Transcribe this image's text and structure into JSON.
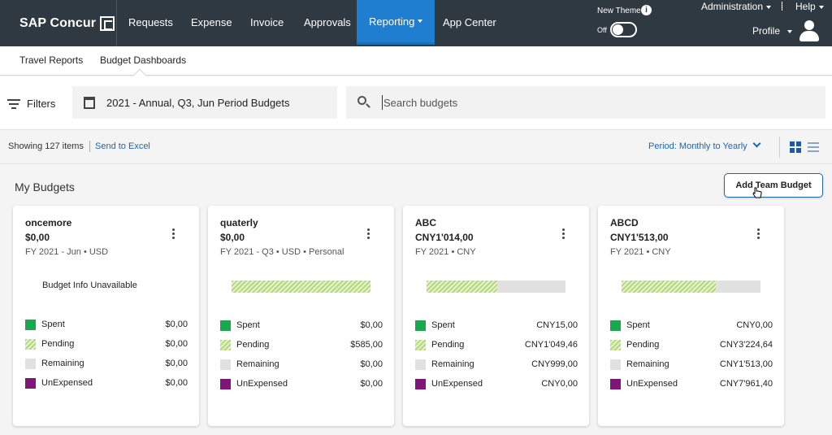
{
  "brand": {
    "name": "SAP Concur"
  },
  "nav": {
    "items": [
      {
        "label": "Requests"
      },
      {
        "label": "Expense"
      },
      {
        "label": "Invoice"
      },
      {
        "label": "Approvals"
      },
      {
        "label": "Reporting"
      },
      {
        "label": "App Center"
      }
    ],
    "active": "Reporting",
    "new_theme_label": "New Theme",
    "toggle_state": "Off",
    "administration": "Administration",
    "help": "Help",
    "profile": "Profile"
  },
  "subnav": {
    "tabs": [
      {
        "label": "Travel Reports"
      },
      {
        "label": "Budget Dashboards"
      }
    ],
    "active": "Budget Dashboards"
  },
  "filterbar": {
    "filters_label": "Filters",
    "period": "2021 - Annual, Q3, Jun Period Budgets",
    "search_placeholder": "Search budgets"
  },
  "toolbar": {
    "showing": "Showing 127 items",
    "send_to_excel": "Send to Excel",
    "period_select": "Period: Monthly to Yearly"
  },
  "main": {
    "title": "My Budgets",
    "add_button": "Add Team Budget"
  },
  "legend_labels": {
    "spent": "Spent",
    "pending": "Pending",
    "remaining": "Remaining",
    "unexpensed": "UnExpensed"
  },
  "colors": {
    "spent": "#1aa84f",
    "pending": "#b4d97d",
    "remaining": "#e1e1e1",
    "unexpensed": "#7e1579",
    "nav_bg": "#2f3941",
    "active_tab": "#1f7ed0",
    "link": "#1a66b5"
  },
  "cards": [
    {
      "name": "oncemore",
      "amount": "$0,00",
      "meta": "FY 2021 - Jun • USD",
      "info_unavailable": "Budget Info Unavailable",
      "spent": "$0,00",
      "pending": "$0,00",
      "remaining": "$0,00",
      "unexpensed": "$0,00"
    },
    {
      "name": "quaterly",
      "amount": "$0,00",
      "meta": "FY 2021 - Q3 • USD • Personal",
      "pending_fraction": 1.0,
      "spent": "$0,00",
      "pending": "$585,00",
      "remaining": "$0,00",
      "unexpensed": "$0,00"
    },
    {
      "name": "ABC",
      "amount": "CNY1'014,00",
      "meta": "FY 2021 • CNY",
      "pending_fraction": 0.51,
      "spent": "CNY15,00",
      "pending": "CNY1'049,46",
      "remaining": "CNY999,00",
      "unexpensed": "CNY0,00"
    },
    {
      "name": "ABCD",
      "amount": "CNY1'513,00",
      "meta": "FY 2021 • CNY",
      "pending_fraction": 0.68,
      "spent": "CNY0,00",
      "pending": "CNY3'224,64",
      "remaining": "CNY1'513,00",
      "unexpensed": "CNY7'961,40"
    }
  ]
}
